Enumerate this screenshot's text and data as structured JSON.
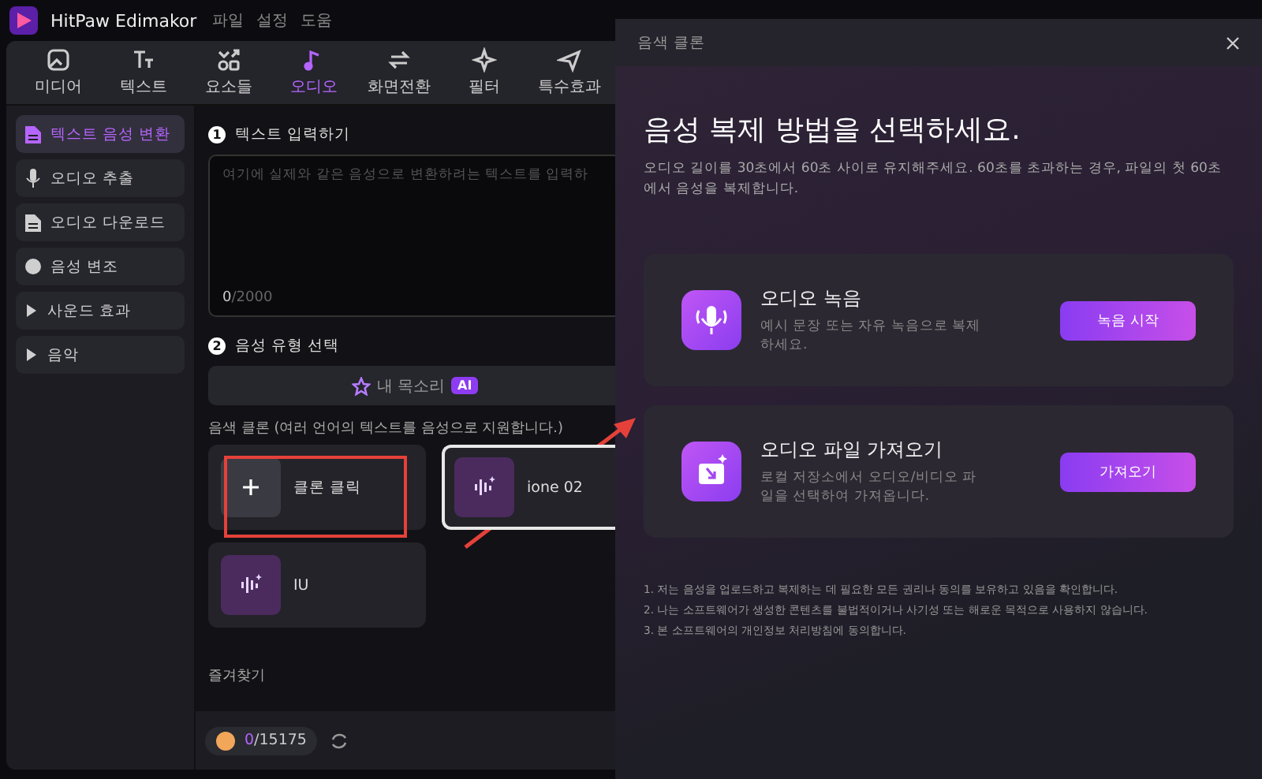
{
  "app": {
    "title": "HitPaw Edimakor",
    "menu": [
      "파일",
      "설정",
      "도움"
    ]
  },
  "toolbar": {
    "tabs": [
      {
        "label": "미디어",
        "selected": false
      },
      {
        "label": "텍스트",
        "selected": false
      },
      {
        "label": "요소들",
        "selected": false
      },
      {
        "label": "오디오",
        "selected": true
      },
      {
        "label": "화면전환",
        "selected": false
      },
      {
        "label": "필터",
        "selected": false
      },
      {
        "label": "특수효과",
        "selected": false
      }
    ]
  },
  "sidebar": {
    "items": [
      {
        "label": "텍스트 음성 변환",
        "selected": true,
        "kind": "item"
      },
      {
        "label": "오디오 추출",
        "selected": false,
        "kind": "item"
      },
      {
        "label": "오디오 다운로드",
        "selected": false,
        "kind": "item"
      },
      {
        "label": "음성 변조",
        "selected": false,
        "kind": "item"
      },
      {
        "label": "사운드 효과",
        "selected": false,
        "kind": "group"
      },
      {
        "label": "음악",
        "selected": false,
        "kind": "group"
      }
    ]
  },
  "text_input": {
    "step": "1",
    "title": "텍스트 입력하기",
    "placeholder": "여기에 실제와 같은 음성으로 변환하려는 텍스트를 입력하",
    "count": "0",
    "max": "/2000"
  },
  "voice_type": {
    "step": "2",
    "title": "음성 유형 선택",
    "my_voice_button": {
      "label": "내 목소리",
      "badge": "AI"
    },
    "clone_caption": "음색 클론 (여러 언어의 텍스트를 음성으로 지원합니다.)",
    "voices": [
      {
        "label": "클론 클릭",
        "kind": "add",
        "selected": false
      },
      {
        "label": "ione 02",
        "kind": "voice",
        "selected": true
      },
      {
        "label": "IU",
        "kind": "voice",
        "selected": false
      }
    ]
  },
  "favorites": "즐겨찾기",
  "credits": {
    "used": "0",
    "total": "/15175"
  },
  "dialog": {
    "title": "음색 클론",
    "heading": "음성 복제 방법을 선택하세요.",
    "description": "오디오 길이를 30초에서 60초 사이로 유지해주세요. 60초를 초과하는 경우, 파일의 첫 60초에서 음성을 복제합니다.",
    "options": [
      {
        "kind": "record",
        "title": "오디오 녹음",
        "description": "예시 문장 또는 자유 녹음으로 복제하세요.",
        "button": "녹음 시작"
      },
      {
        "kind": "import",
        "title": "오디오 파일 가져오기",
        "description": "로컬 저장소에서 오디오/비디오 파일을 선택하여 가져옵니다.",
        "button": "가져오기"
      }
    ],
    "notes": [
      "1. 저는 음성을 업로드하고 복제하는 데 필요한 모든 권리나 동의를 보유하고 있음을 확인합니다.",
      "2. 나는 소프트웨어가 생성한 콘텐츠를 불법적이거나 사기성 또는 해로운 목적으로 사용하지 않습니다.",
      "3. 본 소프트웨어의 개인정보 처리방침에 동의합니다."
    ]
  }
}
